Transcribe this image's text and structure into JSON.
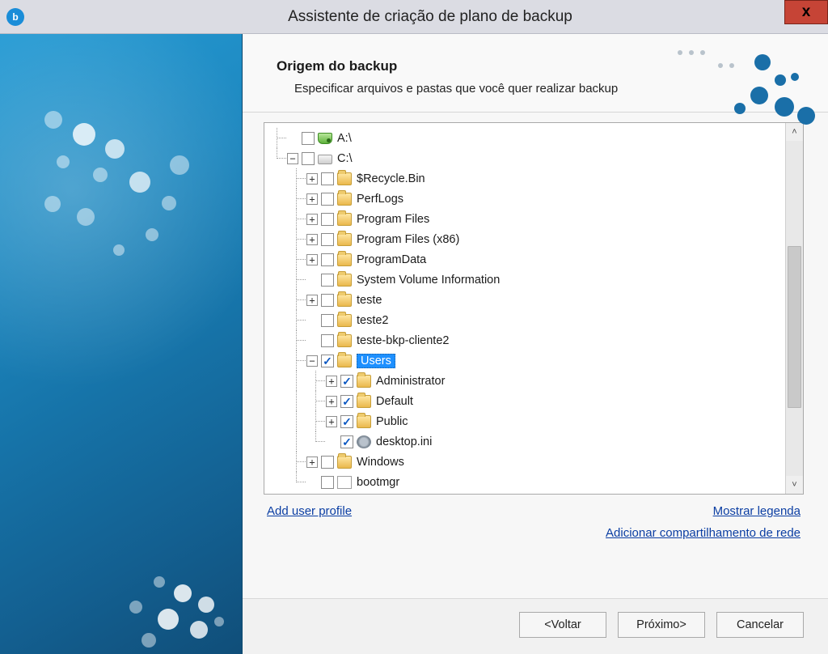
{
  "window": {
    "title": "Assistente de criação de plano de backup"
  },
  "header": {
    "heading": "Origem do backup",
    "subtitle": "Especificar arquivos e pastas que você quer realizar backup"
  },
  "tree": {
    "nodes": [
      {
        "id": "a",
        "indent": [
          "tee"
        ],
        "expander": "none",
        "checked": false,
        "icon": "drive-green",
        "label": "A:\\"
      },
      {
        "id": "c",
        "indent": [
          "end"
        ],
        "expander": "minus",
        "checked": false,
        "icon": "drive",
        "label": "C:\\"
      },
      {
        "id": "recycle",
        "indent": [
          "blank",
          "tee"
        ],
        "expander": "plus",
        "checked": false,
        "icon": "folder",
        "label": "$Recycle.Bin"
      },
      {
        "id": "perflogs",
        "indent": [
          "blank",
          "tee"
        ],
        "expander": "plus",
        "checked": false,
        "icon": "folder",
        "label": "PerfLogs"
      },
      {
        "id": "pf",
        "indent": [
          "blank",
          "tee"
        ],
        "expander": "plus",
        "checked": false,
        "icon": "folder",
        "label": "Program Files"
      },
      {
        "id": "pf86",
        "indent": [
          "blank",
          "tee"
        ],
        "expander": "plus",
        "checked": false,
        "icon": "folder",
        "label": "Program Files (x86)"
      },
      {
        "id": "pdata",
        "indent": [
          "blank",
          "tee"
        ],
        "expander": "plus",
        "checked": false,
        "icon": "folder",
        "label": "ProgramData"
      },
      {
        "id": "svi",
        "indent": [
          "blank",
          "tee"
        ],
        "expander": "none",
        "checked": false,
        "icon": "folder",
        "label": "System Volume Information"
      },
      {
        "id": "teste",
        "indent": [
          "blank",
          "tee"
        ],
        "expander": "plus",
        "checked": false,
        "icon": "folder",
        "label": "teste"
      },
      {
        "id": "teste2",
        "indent": [
          "blank",
          "tee"
        ],
        "expander": "none",
        "checked": false,
        "icon": "folder",
        "label": "teste2"
      },
      {
        "id": "testebkp",
        "indent": [
          "blank",
          "tee"
        ],
        "expander": "none",
        "checked": false,
        "icon": "folder",
        "label": "teste-bkp-cliente2"
      },
      {
        "id": "users",
        "indent": [
          "blank",
          "tee"
        ],
        "expander": "minus",
        "checked": true,
        "icon": "folder",
        "label": "Users",
        "selected": true
      },
      {
        "id": "admin",
        "indent": [
          "blank",
          "line",
          "tee"
        ],
        "expander": "plus",
        "checked": true,
        "icon": "folder",
        "label": "Administrator"
      },
      {
        "id": "default",
        "indent": [
          "blank",
          "line",
          "tee"
        ],
        "expander": "plus",
        "checked": true,
        "icon": "folder",
        "label": "Default"
      },
      {
        "id": "public",
        "indent": [
          "blank",
          "line",
          "tee"
        ],
        "expander": "plus",
        "checked": true,
        "icon": "folder",
        "label": "Public"
      },
      {
        "id": "desktop",
        "indent": [
          "blank",
          "line",
          "end"
        ],
        "expander": "none",
        "checked": true,
        "icon": "gear",
        "label": "desktop.ini"
      },
      {
        "id": "windows",
        "indent": [
          "blank",
          "tee"
        ],
        "expander": "plus",
        "checked": false,
        "icon": "folder",
        "label": "Windows"
      },
      {
        "id": "bootmgr",
        "indent": [
          "blank",
          "end"
        ],
        "expander": "none",
        "checked": false,
        "icon": "file",
        "label": "bootmgr"
      }
    ]
  },
  "links": {
    "add_profile": "Add user profile",
    "show_legend": "Mostrar legenda",
    "add_share": "Adicionar  compartilhamento de rede"
  },
  "buttons": {
    "back": "<Voltar",
    "next": "Próximo>",
    "cancel": "Cancelar"
  }
}
